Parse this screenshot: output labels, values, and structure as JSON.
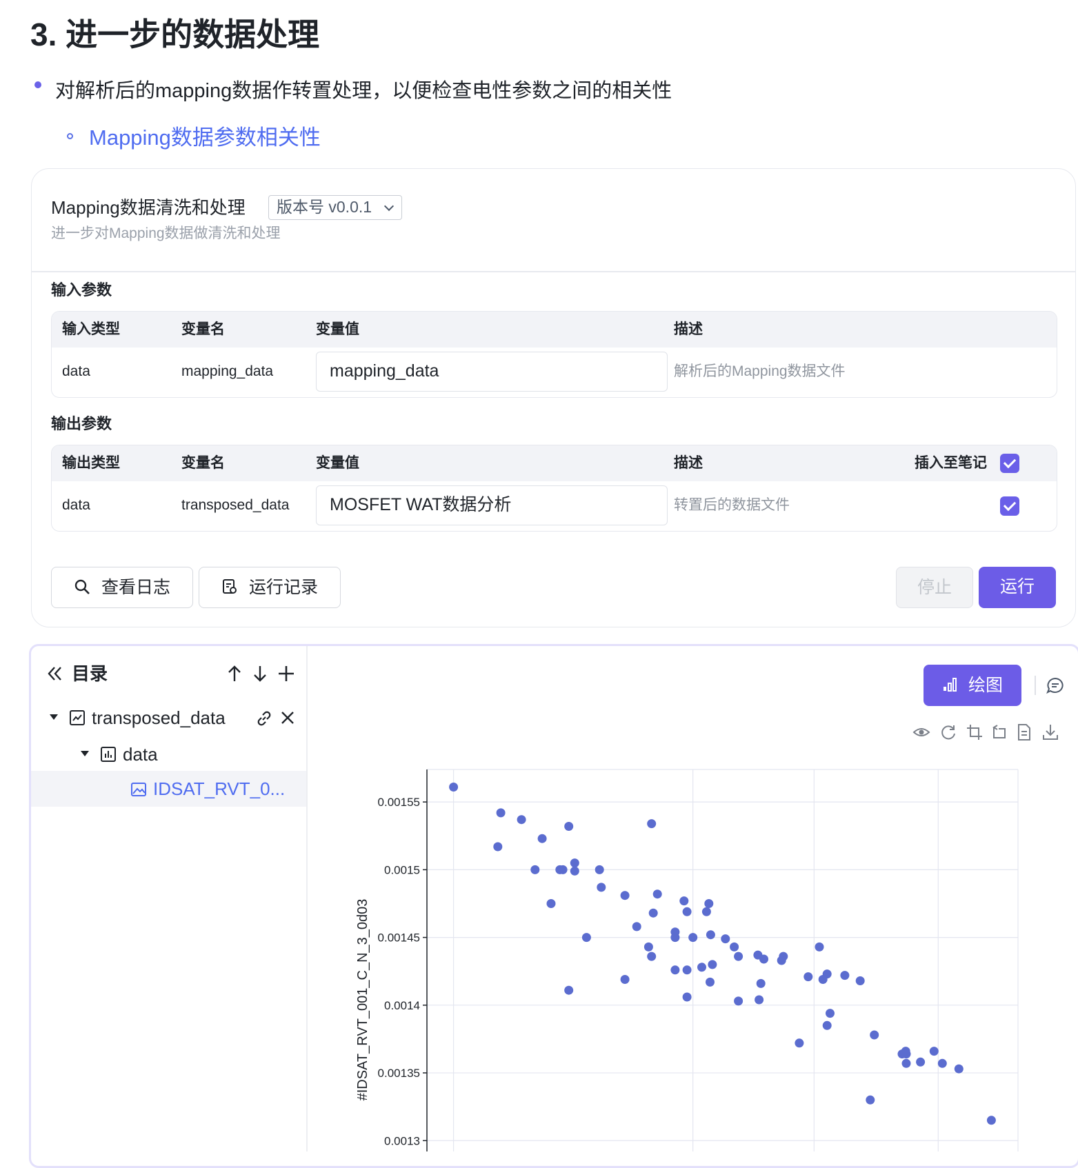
{
  "heading": "3. 进一步的数据处理",
  "bullet": "对解析后的mapping数据作转置处理，以便检查电性参数之间的相关性",
  "link": "Mapping数据参数相关性",
  "card": {
    "title": "Mapping数据清洗和处理",
    "version": "版本号 v0.0.1",
    "subtitle": "进一步对Mapping数据做清洗和处理"
  },
  "input_params": {
    "label": "输入参数",
    "headers": [
      "输入类型",
      "变量名",
      "变量值",
      "描述"
    ],
    "row": {
      "type": "data",
      "name": "mapping_data",
      "value": "mapping_data",
      "desc": "解析后的Mapping数据文件"
    }
  },
  "output_params": {
    "label": "输出参数",
    "headers": [
      "输出类型",
      "变量名",
      "变量值",
      "描述",
      "插入至笔记"
    ],
    "row": {
      "type": "data",
      "name": "transposed_data",
      "value": "MOSFET WAT数据分析",
      "desc": "转置后的数据文件"
    }
  },
  "buttons": {
    "view_log": "查看日志",
    "run_history": "运行记录",
    "stop": "停止",
    "run": "运行"
  },
  "toc": {
    "title": "目录",
    "root": "transposed_data",
    "child": "data",
    "leaf": "IDSAT_RVT_0..."
  },
  "chart_toolbar": {
    "draw_label": "绘图",
    "tools": [
      "eye-icon",
      "refresh-icon",
      "crop-icon",
      "crop-alt-icon",
      "document-icon",
      "download-icon"
    ]
  },
  "colors": {
    "accent": "#6c5ce7",
    "point": "#5b6ccf",
    "link": "#4f6cf0"
  },
  "chart_data": {
    "type": "scatter",
    "ylabel": "#IDSAT_RVT_001_C_N_3_0d03",
    "yticks": [
      "0.00155",
      "0.0015",
      "0.00145",
      "0.0014",
      "0.00135",
      "0.0013"
    ],
    "ylim": [
      0.001292,
      0.001574
    ],
    "xlim": [
      0,
      1
    ],
    "grid": true,
    "points": [
      [
        0.045,
        0.001561
      ],
      [
        0.125,
        0.001542
      ],
      [
        0.16,
        0.001537
      ],
      [
        0.12,
        0.001517
      ],
      [
        0.195,
        0.001523
      ],
      [
        0.24,
        0.001532
      ],
      [
        0.38,
        0.001534
      ],
      [
        0.183,
        0.0015
      ],
      [
        0.23,
        0.0015
      ],
      [
        0.225,
        0.0015
      ],
      [
        0.25,
        0.001505
      ],
      [
        0.25,
        0.001499
      ],
      [
        0.292,
        0.0015
      ],
      [
        0.295,
        0.001487
      ],
      [
        0.335,
        0.001481
      ],
      [
        0.21,
        0.001475
      ],
      [
        0.39,
        0.001482
      ],
      [
        0.435,
        0.001477
      ],
      [
        0.44,
        0.001469
      ],
      [
        0.477,
        0.001475
      ],
      [
        0.383,
        0.001468
      ],
      [
        0.473,
        0.001469
      ],
      [
        0.355,
        0.001458
      ],
      [
        0.27,
        0.00145
      ],
      [
        0.42,
        0.001454
      ],
      [
        0.45,
        0.00145
      ],
      [
        0.48,
        0.001452
      ],
      [
        0.505,
        0.001449
      ],
      [
        0.375,
        0.001443
      ],
      [
        0.38,
        0.001436
      ],
      [
        0.42,
        0.00145
      ],
      [
        0.52,
        0.001443
      ],
      [
        0.527,
        0.001436
      ],
      [
        0.56,
        0.001437
      ],
      [
        0.42,
        0.001426
      ],
      [
        0.44,
        0.001426
      ],
      [
        0.465,
        0.001428
      ],
      [
        0.483,
        0.00143
      ],
      [
        0.479,
        0.001417
      ],
      [
        0.603,
        0.001436
      ],
      [
        0.6,
        0.001433
      ],
      [
        0.57,
        0.001434
      ],
      [
        0.335,
        0.001419
      ],
      [
        0.24,
        0.001411
      ],
      [
        0.44,
        0.001406
      ],
      [
        0.527,
        0.001403
      ],
      [
        0.562,
        0.001404
      ],
      [
        0.565,
        0.001416
      ],
      [
        0.664,
        0.001443
      ],
      [
        0.645,
        0.001421
      ],
      [
        0.67,
        0.001419
      ],
      [
        0.677,
        0.001423
      ],
      [
        0.707,
        0.001422
      ],
      [
        0.733,
        0.001418
      ],
      [
        0.682,
        0.001394
      ],
      [
        0.677,
        0.001385
      ],
      [
        0.63,
        0.001372
      ],
      [
        0.757,
        0.001378
      ],
      [
        0.81,
        0.001366
      ],
      [
        0.811,
        0.001364
      ],
      [
        0.804,
        0.001364
      ],
      [
        0.858,
        0.001366
      ],
      [
        0.835,
        0.001358
      ],
      [
        0.811,
        0.001357
      ],
      [
        0.872,
        0.001357
      ],
      [
        0.9,
        0.001353
      ],
      [
        0.75,
        0.00133
      ],
      [
        0.955,
        0.001315
      ]
    ]
  }
}
